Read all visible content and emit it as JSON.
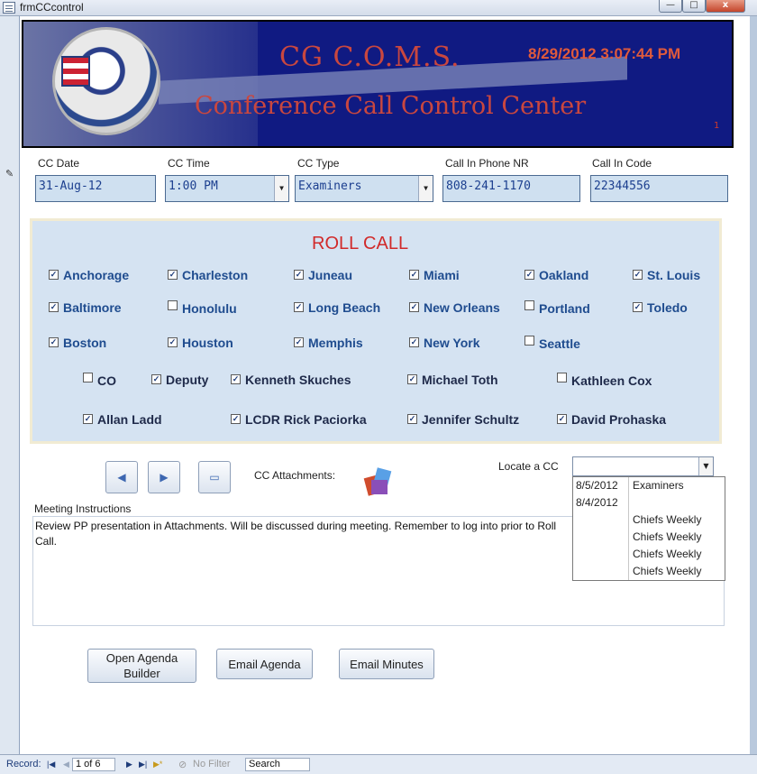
{
  "window": {
    "title": "frmCCcontrol",
    "minimize": "—",
    "maximize": "□",
    "close": "x"
  },
  "header": {
    "title": "CG C.O.M.S.",
    "subtitle": "Conference Call Control Center",
    "datetime": "8/29/2012 3:07:44 PM",
    "record_num": "1"
  },
  "fields": {
    "cc_date": {
      "label": "CC Date",
      "value": "31-Aug-12"
    },
    "cc_time": {
      "label": "CC Time",
      "value": "1:00 PM"
    },
    "cc_type": {
      "label": "CC Type",
      "value": "Examiners"
    },
    "phone": {
      "label": "Call In Phone NR",
      "value": "808-241-1170"
    },
    "code": {
      "label": "Call In Code",
      "value": "22344556"
    }
  },
  "roll_call": {
    "title": "ROLL CALL",
    "locations": [
      {
        "name": "Anchorage",
        "checked": true
      },
      {
        "name": "Charleston",
        "checked": true
      },
      {
        "name": "Juneau",
        "checked": true
      },
      {
        "name": "Miami",
        "checked": true
      },
      {
        "name": "Oakland",
        "checked": true
      },
      {
        "name": "St. Louis",
        "checked": true
      },
      {
        "name": "Baltimore",
        "checked": true
      },
      {
        "name": "Honolulu",
        "checked": false
      },
      {
        "name": "Long Beach",
        "checked": true
      },
      {
        "name": "New Orleans",
        "checked": true
      },
      {
        "name": "Portland",
        "checked": false
      },
      {
        "name": "Toledo",
        "checked": true
      },
      {
        "name": "Boston",
        "checked": true
      },
      {
        "name": "Houston",
        "checked": true
      },
      {
        "name": "Memphis",
        "checked": true
      },
      {
        "name": "New York",
        "checked": true
      },
      {
        "name": "Seattle",
        "checked": false
      }
    ],
    "people": [
      {
        "name": "CO",
        "checked": false
      },
      {
        "name": "Deputy",
        "checked": true
      },
      {
        "name": "Kenneth Skuches",
        "checked": true
      },
      {
        "name": "Michael Toth",
        "checked": true
      },
      {
        "name": "Kathleen Cox",
        "checked": false
      },
      {
        "name": "Allan Ladd",
        "checked": true
      },
      {
        "name": "LCDR Rick Paciorka",
        "checked": true
      },
      {
        "name": "Jennifer Schultz",
        "checked": true
      },
      {
        "name": "David Prohaska",
        "checked": true
      }
    ]
  },
  "nav": {
    "prev_icon": "◀",
    "next_icon": "▶",
    "attach_icon": "▭"
  },
  "attachments_label": "CC Attachments:",
  "locate": {
    "label": "Locate a CC",
    "value": "",
    "options": [
      {
        "date": "8/5/2012",
        "type": "Examiners"
      },
      {
        "date": "8/4/2012",
        "type": ""
      },
      {
        "date": "",
        "type": "Chiefs Weekly"
      },
      {
        "date": "",
        "type": "Chiefs Weekly"
      },
      {
        "date": "",
        "type": "Chiefs Weekly"
      },
      {
        "date": "",
        "type": "Chiefs Weekly"
      }
    ]
  },
  "meeting": {
    "label": "Meeting Instructions",
    "text": "Review PP presentation in Attachments.  Will be discussed during meeting.  Remember to log into prior to Roll Call."
  },
  "buttons": {
    "open_agenda": "Open Agenda Builder",
    "email_agenda": "Email Agenda",
    "email_minutes": "Email Minutes"
  },
  "statusbar": {
    "record_label": "Record:",
    "first": "|◀",
    "prev": "◀",
    "position": "1 of 6",
    "next": "▶",
    "last": "▶|",
    "new": "▶*",
    "filter": "No Filter",
    "search": "Search"
  },
  "colors": {
    "header_bg": "#101a82",
    "title_red": "#c9473f",
    "rollcall_bg": "#d5e3f2",
    "field_text": "#1c3f8f"
  }
}
